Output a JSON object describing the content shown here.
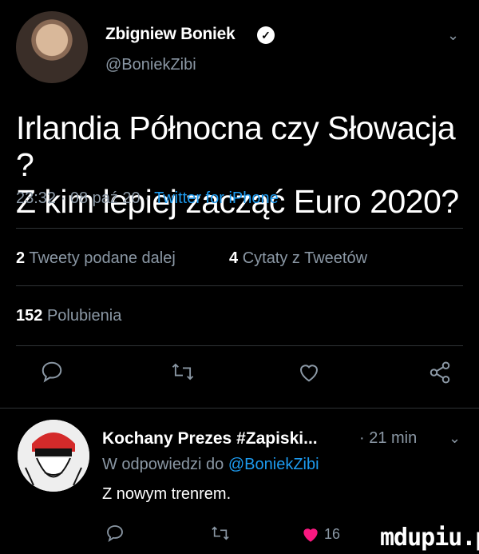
{
  "tweet": {
    "author_name": "Zbigniew Boniek",
    "handle": "@BoniekZibi",
    "text": "Irlandia Północna czy Słowacja ?\nZ kim lepiej zacząć Euro 2020?",
    "time": "23:32 · 08 paź 20 ·",
    "source": "Twitter for iPhone"
  },
  "stats": {
    "retweets_count": "2",
    "retweets_label": "Tweety podane dalej",
    "quotes_count": "4",
    "quotes_label": "Cytaty z Tweetów",
    "likes_count": "152",
    "likes_label": "Polubienia"
  },
  "reply": {
    "author_name": "Kochany Prezes #Zapiski...",
    "time": "· 21 min",
    "reply_prefix": "W odpowiedzi do",
    "reply_to": "@BoniekZibi",
    "text": "Z nowym trenrem.",
    "like_count": "16"
  },
  "icons": [
    "verified-icon",
    "chevron-down-icon",
    "reply-icon",
    "retweet-icon",
    "like-icon",
    "share-icon"
  ],
  "colors": {
    "background": "#000000",
    "accent": "#1d9bf0",
    "secondary": "#8b98a5",
    "like": "#f91880"
  },
  "watermark": "mdupiu.pl"
}
